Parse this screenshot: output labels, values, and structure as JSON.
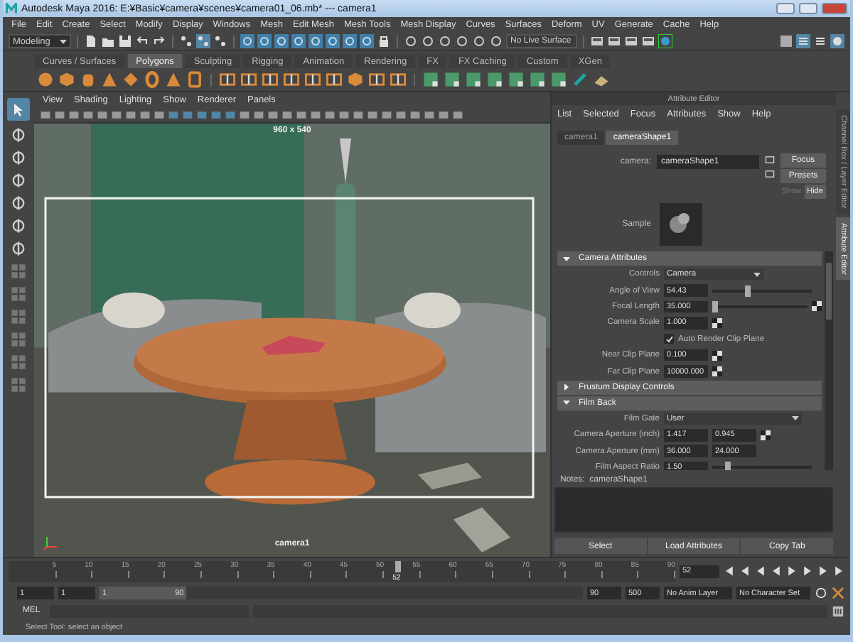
{
  "window": {
    "title": "Autodesk Maya 2016: E:¥Basic¥camera¥scenes¥camera01_06.mb*   ---   camera1"
  },
  "menu": [
    "File",
    "Edit",
    "Create",
    "Select",
    "Modify",
    "Display",
    "Windows",
    "Mesh",
    "Edit Mesh",
    "Mesh Tools",
    "Mesh Display",
    "Curves",
    "Surfaces",
    "Deform",
    "UV",
    "Generate",
    "Cache",
    "Help"
  ],
  "status_line": {
    "mode": "Modeling",
    "live_surface": "No Live Surface"
  },
  "shelf": {
    "tabs": [
      {
        "label": "Curves / Surfaces",
        "selected": false
      },
      {
        "label": "Polygons",
        "selected": true
      },
      {
        "label": "Sculpting",
        "selected": false
      },
      {
        "label": "Rigging",
        "selected": false
      },
      {
        "label": "Animation",
        "selected": false
      },
      {
        "label": "Rendering",
        "selected": false
      },
      {
        "label": "FX",
        "selected": false
      },
      {
        "label": "FX Caching",
        "selected": false
      },
      {
        "label": "Custom",
        "selected": false
      },
      {
        "label": "XGen",
        "selected": false
      }
    ]
  },
  "viewport": {
    "menu": [
      "View",
      "Shading",
      "Lighting",
      "Show",
      "Renderer",
      "Panels"
    ],
    "resolution": "960 x 540",
    "camera": "camera1"
  },
  "attribute_editor": {
    "title": "Attribute Editor",
    "menu": [
      "List",
      "Selected",
      "Focus",
      "Attributes",
      "Show",
      "Help"
    ],
    "tabs": [
      {
        "label": "camera1",
        "selected": false
      },
      {
        "label": "cameraShape1",
        "selected": true
      }
    ],
    "node_label": "camera:",
    "node_name": "cameraShape1",
    "buttons": [
      "Focus",
      "Presets"
    ],
    "show_hide": [
      {
        "label": "Show",
        "selected": false
      },
      {
        "label": "Hide",
        "selected": true
      }
    ],
    "sample_label": "Sample",
    "sections": [
      {
        "title": "Camera Attributes",
        "expanded": true,
        "rows": [
          {
            "kind": "dropdown",
            "label": "Controls",
            "value": "Camera",
            "wide": false
          },
          {
            "kind": "number",
            "label": "Angle of View",
            "value": "54.43",
            "slider": true,
            "level": 0.35,
            "map": false
          },
          {
            "kind": "number",
            "label": "Focal Length",
            "value": "35.000",
            "slider": true,
            "level": 0.03,
            "map": true
          },
          {
            "kind": "number",
            "label": "Camera Scale",
            "value": "1.000",
            "slider": false,
            "map": true
          },
          {
            "kind": "checkbox",
            "label": "Auto Render Clip Plane",
            "checked": true
          },
          {
            "kind": "number",
            "label": "Near Clip Plane",
            "value": "0.100",
            "slider": false,
            "map": true
          },
          {
            "kind": "number",
            "label": "Far Clip Plane",
            "value": "10000.000",
            "slider": false,
            "map": true
          }
        ]
      },
      {
        "title": "Frustum Display Controls",
        "expanded": false
      },
      {
        "title": "Film Back",
        "expanded": true,
        "rows": [
          {
            "kind": "dropdown",
            "label": "Film Gate",
            "value": "User",
            "wide": true
          },
          {
            "kind": "pair",
            "label": "Camera Aperture (inch)",
            "values": [
              "1.417",
              "0.945"
            ],
            "map": true
          },
          {
            "kind": "pair",
            "label": "Camera Aperture (mm)",
            "values": [
              "36.000",
              "24.000"
            ],
            "map": false
          },
          {
            "kind": "number",
            "label": "Film Aspect Ratio",
            "value": "1.50",
            "slider": true,
            "level": 0.15,
            "map": false
          }
        ]
      }
    ],
    "notes_label": "Notes:  cameraShape1",
    "bottom_buttons": [
      "Select",
      "Load Attributes",
      "Copy Tab"
    ]
  },
  "side_tabs": [
    {
      "label": "Channel Box / Layer Editor",
      "selected": false
    },
    {
      "label": "Attribute Editor",
      "selected": true
    }
  ],
  "timeline": {
    "ticks": [
      "5",
      "10",
      "15",
      "20",
      "25",
      "30",
      "35",
      "40",
      "45",
      "50",
      "55",
      "60",
      "65",
      "70",
      "75",
      "80",
      "85",
      "90"
    ],
    "current": "52",
    "level": 0.573,
    "current_field": "52"
  },
  "range": {
    "start": "1",
    "playback_start": "1",
    "slider_start": "1",
    "slider_end": "90",
    "playback_end": "90",
    "level": 0.18,
    "end": "500",
    "anim_layer": "No Anim Layer",
    "character_set": "No Character Set"
  },
  "command_line": {
    "label": "MEL"
  },
  "help_line": "Select Tool: select an object"
}
